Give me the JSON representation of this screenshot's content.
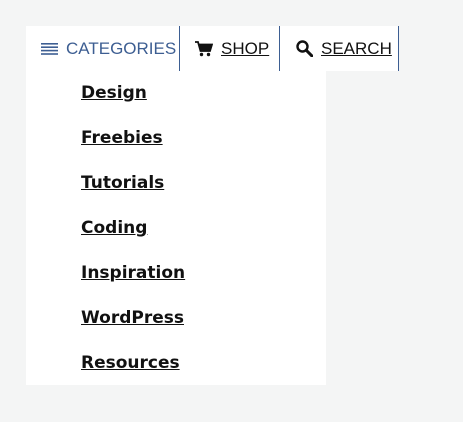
{
  "nav": {
    "categories": {
      "label": "CATEGORIES",
      "icon": "menu-lines-icon"
    },
    "shop": {
      "label": "SHOP",
      "icon": "cart-icon"
    },
    "search": {
      "label": "SEARCH",
      "icon": "search-icon"
    }
  },
  "dropdown": {
    "items": [
      {
        "label": "Design"
      },
      {
        "label": "Freebies"
      },
      {
        "label": "Tutorials"
      },
      {
        "label": "Coding"
      },
      {
        "label": "Inspiration"
      },
      {
        "label": "WordPress"
      },
      {
        "label": "Resources"
      }
    ]
  },
  "colors": {
    "accent": "#3d5e92",
    "text": "#111111",
    "page_background": "#f4f5f5",
    "panel_background": "#ffffff"
  }
}
